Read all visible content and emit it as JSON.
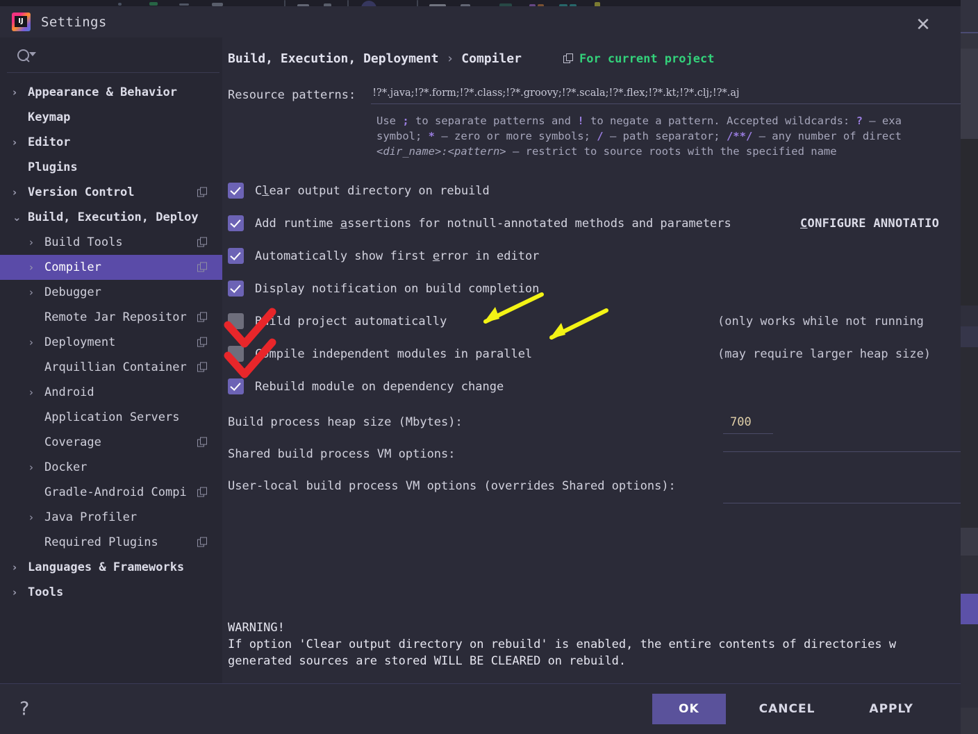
{
  "window": {
    "title": "Settings",
    "logo_icon": "intellij-idea-logo",
    "close_icon": "close-icon"
  },
  "sidebar": {
    "search": {
      "placeholder": "",
      "value": "",
      "icon": "search-icon",
      "dropdown_icon": "chevron-down-icon"
    },
    "items": [
      {
        "label": "Appearance & Behavior",
        "level": 0,
        "arrow": "collapsed",
        "copy": false,
        "selected": false
      },
      {
        "label": "Keymap",
        "level": 0,
        "arrow": "none",
        "copy": false,
        "selected": false
      },
      {
        "label": "Editor",
        "level": 0,
        "arrow": "collapsed",
        "copy": false,
        "selected": false
      },
      {
        "label": "Plugins",
        "level": 0,
        "arrow": "none",
        "copy": false,
        "selected": false
      },
      {
        "label": "Version Control",
        "level": 0,
        "arrow": "collapsed",
        "copy": true,
        "selected": false
      },
      {
        "label": "Build, Execution, Deploy",
        "level": 0,
        "arrow": "expanded",
        "copy": false,
        "selected": false
      },
      {
        "label": "Build Tools",
        "level": 1,
        "arrow": "collapsed",
        "copy": true,
        "selected": false
      },
      {
        "label": "Compiler",
        "level": 1,
        "arrow": "collapsed",
        "copy": true,
        "selected": true
      },
      {
        "label": "Debugger",
        "level": 1,
        "arrow": "collapsed",
        "copy": false,
        "selected": false
      },
      {
        "label": "Remote Jar Repositor",
        "level": 1,
        "arrow": "none",
        "copy": true,
        "selected": false
      },
      {
        "label": "Deployment",
        "level": 1,
        "arrow": "collapsed",
        "copy": true,
        "selected": false
      },
      {
        "label": "Arquillian Container",
        "level": 1,
        "arrow": "none",
        "copy": true,
        "selected": false
      },
      {
        "label": "Android",
        "level": 1,
        "arrow": "collapsed",
        "copy": false,
        "selected": false
      },
      {
        "label": "Application Servers",
        "level": 1,
        "arrow": "none",
        "copy": false,
        "selected": false
      },
      {
        "label": "Coverage",
        "level": 1,
        "arrow": "none",
        "copy": true,
        "selected": false
      },
      {
        "label": "Docker",
        "level": 1,
        "arrow": "collapsed",
        "copy": false,
        "selected": false
      },
      {
        "label": "Gradle-Android Compi",
        "level": 1,
        "arrow": "none",
        "copy": true,
        "selected": false
      },
      {
        "label": "Java Profiler",
        "level": 1,
        "arrow": "collapsed",
        "copy": false,
        "selected": false
      },
      {
        "label": "Required Plugins",
        "level": 1,
        "arrow": "none",
        "copy": true,
        "selected": false
      },
      {
        "label": "Languages & Frameworks",
        "level": 0,
        "arrow": "collapsed",
        "copy": false,
        "selected": false
      },
      {
        "label": "Tools",
        "level": 0,
        "arrow": "collapsed",
        "copy": false,
        "selected": false
      }
    ]
  },
  "main": {
    "breadcrumb": {
      "root": "Build, Execution, Deployment",
      "separator": "›",
      "leaf": "Compiler"
    },
    "for_current_project": {
      "label": "For current project",
      "icon": "copy-settings-icon",
      "color": "#33d17a"
    },
    "resource_patterns": {
      "label": "Resource patterns:",
      "value": "!?*.java;!?*.form;!?*.class;!?*.groovy;!?*.scala;!?*.flex;!?*.kt;!?*.clj;!?*.aj",
      "help_line1_a": "Use ",
      "help_line1_sep": ";",
      "help_line1_b": " to separate patterns and ",
      "help_line1_neg": "!",
      "help_line1_c": " to negate a pattern. Accepted wildcards: ",
      "help_line1_q": "?",
      "help_line1_d": " — exa",
      "help_line2_a": "symbol; ",
      "help_line2_star": "*",
      "help_line2_b": " — zero or more symbols; ",
      "help_line2_slash": "/",
      "help_line2_c": " — path separator; ",
      "help_line2_ds": "/**/",
      "help_line2_d": " — any number of direct",
      "help_line3_it": "<dir_name>:<pattern>",
      "help_line3_b": " — restrict to source roots with the specified name"
    },
    "checkboxes": [
      {
        "checked": true,
        "label_pre": "C",
        "label_mnemonic": "l",
        "label_post": "ear output directory on rebuild",
        "note": "",
        "link": ""
      },
      {
        "checked": true,
        "label_pre": "Add runtime ",
        "label_mnemonic": "a",
        "label_post": "ssertions for notnull-annotated methods and parameters",
        "note": "",
        "link": "CONFIGURE ANNOTATIO",
        "link_mnemonic": "C"
      },
      {
        "checked": true,
        "label_pre": "Automatically show first ",
        "label_mnemonic": "e",
        "label_post": "rror in editor",
        "note": "",
        "link": ""
      },
      {
        "checked": true,
        "label_pre": "Display notification on build completion",
        "label_mnemonic": "",
        "label_post": "",
        "note": "",
        "link": ""
      },
      {
        "checked": false,
        "label_pre": "Build project automatically",
        "label_mnemonic": "",
        "label_post": "",
        "note": "(only works while not running",
        "link": ""
      },
      {
        "checked": false,
        "label_pre": "Compile independent modules in parallel",
        "label_mnemonic": "",
        "label_post": "",
        "note": "(may require larger heap size)",
        "link": ""
      },
      {
        "checked": true,
        "label_pre": "Rebuild module on dependency change",
        "label_mnemonic": "",
        "label_post": "",
        "note": "",
        "link": ""
      }
    ],
    "fields": [
      {
        "label": "Build process heap size (Mbytes):",
        "value": "700",
        "width": "short"
      },
      {
        "label": "Shared build process VM options:",
        "value": "",
        "width": "wide"
      },
      {
        "label": "User-local build process VM options (overrides Shared options):",
        "value": "",
        "width": "wide"
      }
    ],
    "warning": {
      "heading": "WARNING!",
      "line1": "If option 'Clear output directory on rebuild' is enabled, the entire contents of directories w",
      "line2": "generated sources are stored WILL BE CLEARED on rebuild."
    }
  },
  "footer": {
    "help_icon": "question-mark-icon",
    "ok": "OK",
    "cancel": "CANCEL",
    "apply": "APPLY"
  },
  "annotations": {
    "red_check_1": "red-checkmark-over-build-project-automatically",
    "red_check_2": "red-checkmark-over-compile-independent-modules",
    "yellow_arrow_1": "yellow-arrow-pointing-to-build-project-automatically",
    "yellow_arrow_2": "yellow-arrow-pointing-to-compile-independent-modules",
    "red_color": "#e8262a",
    "yellow_color": "#f3f315"
  }
}
